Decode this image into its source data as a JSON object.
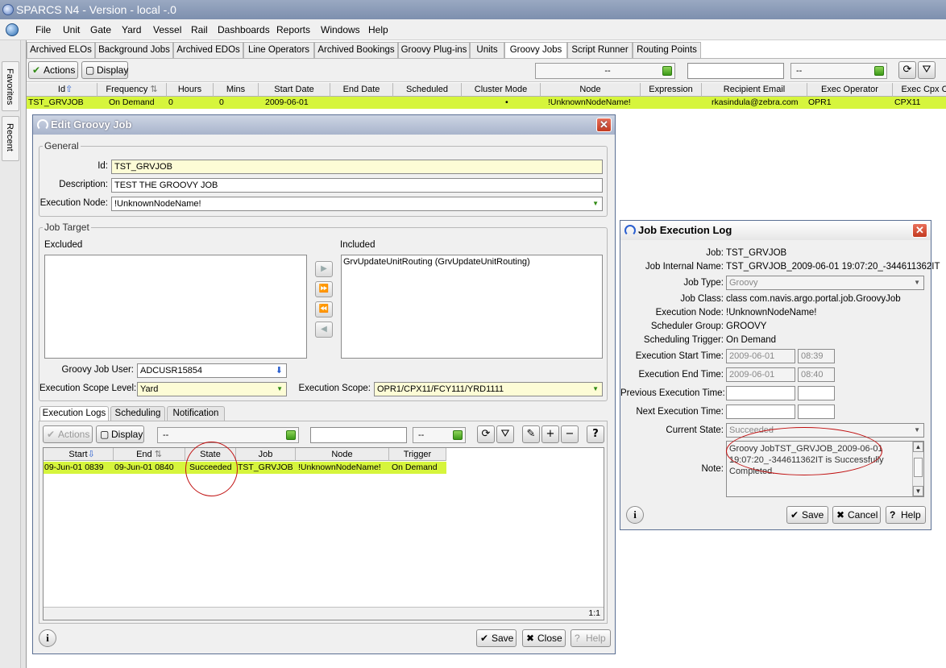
{
  "app": {
    "title": "SPARCS N4 - Version - local -.0"
  },
  "menu": [
    "File",
    "Unit",
    "Gate",
    "Yard",
    "Vessel",
    "Rail",
    "Dashboards",
    "Reports",
    "Windows",
    "Help"
  ],
  "side_tabs": [
    "Favorites",
    "Recent"
  ],
  "tabs": [
    "Archived ELOs",
    "Background Jobs",
    "Archived EDOs",
    "Line Operators",
    "Archived Bookings",
    "Groovy Plug-ins",
    "Units",
    "Groovy Jobs",
    "Script Runner",
    "Routing Points"
  ],
  "toolbar": {
    "actions": "Actions",
    "display": "Display",
    "combo1": "--",
    "combo2": "--"
  },
  "grid": {
    "headers": [
      "Id",
      "Frequency",
      "Hours",
      "Mins",
      "Start Date",
      "End Date",
      "Scheduled",
      "Cluster Mode",
      "Node",
      "Expression",
      "Recipient Email",
      "Exec Operator",
      "Exec Cpx C"
    ],
    "row": [
      "TST_GRVJOB",
      "On Demand",
      "0",
      "0",
      "2009-06-01",
      "",
      "",
      "•",
      "!UnknownNodeName!",
      "",
      "rkasindula@zebra.com",
      "OPR1",
      "CPX11"
    ]
  },
  "edit": {
    "title": "Edit Groovy Job",
    "general_label": "General",
    "id_label": "Id:",
    "id": "TST_GRVJOB",
    "desc_label": "Description:",
    "desc": "TEST THE GROOVY JOB",
    "node_label": "Execution Node:",
    "node": "!UnknownNodeName!",
    "target_label": "Job Target",
    "excluded": "Excluded",
    "included": "Included",
    "included_item": "GrvUpdateUnitRouting (GrvUpdateUnitRouting)",
    "user_label": "Groovy Job User:",
    "user": "ADCUSR15854",
    "scope_level_label": "Execution Scope Level:",
    "scope_level": "Yard",
    "scope_label": "Execution Scope:",
    "scope": "OPR1/CPX11/FCY111/YRD1111",
    "subtabs": [
      "Execution Logs",
      "Scheduling",
      "Notification"
    ],
    "actions": "Actions",
    "display": "Display",
    "combo1": "--",
    "combo2": "--",
    "log_headers": [
      "Start",
      "End",
      "State",
      "Job",
      "Node",
      "Trigger"
    ],
    "log_row": [
      "09-Jun-01 0839",
      "09-Jun-01 0840",
      "Succeeded",
      "TST_GRVJOB",
      "!UnknownNodeName!",
      "On Demand"
    ],
    "count": "1:1",
    "save": "Save",
    "close": "Close",
    "help": "Help"
  },
  "log": {
    "title": "Job Execution Log",
    "job_label": "Job:",
    "job": "TST_GRVJOB",
    "internal_label": "Job Internal Name:",
    "internal": "TST_GRVJOB_2009-06-01 19:07:20_-344611362IT",
    "type_label": "Job Type:",
    "type": "Groovy",
    "class_label": "Job Class:",
    "class": "class com.navis.argo.portal.job.GroovyJob",
    "node_label": "Execution Node:",
    "node": "!UnknownNodeName!",
    "group_label": "Scheduler Group:",
    "group": "GROOVY",
    "trigger_label": "Scheduling Trigger:",
    "trigger": "On Demand",
    "start_label": "Execution Start Time:",
    "start_date": "2009-06-01",
    "start_time": "08:39",
    "end_label": "Execution End Time:",
    "end_date": "2009-06-01",
    "end_time": "08:40",
    "prev_label": "Previous Execution Time:",
    "next_label": "Next Execution Time:",
    "state_label": "Current State:",
    "state": "Succeeded",
    "note_label": "Note:",
    "note": "Groovy JobTST_GRVJOB_2009-06-01 19:07:20_-344611362IT is Successfully Completed.",
    "save": "Save",
    "cancel": "Cancel",
    "help": "Help"
  }
}
